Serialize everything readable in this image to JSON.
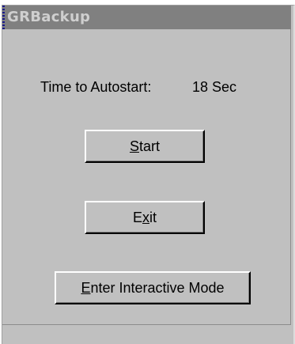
{
  "window": {
    "title": "GRBackup"
  },
  "autostart": {
    "label": "Time to Autostart:",
    "value": "18 Sec"
  },
  "buttons": {
    "start": {
      "mnemonic": "S",
      "rest": "tart"
    },
    "exit": {
      "pre": "E",
      "mnemonic": "x",
      "rest": "it"
    },
    "interactive": {
      "mnemonic": "E",
      "rest": "nter Interactive Mode"
    }
  }
}
